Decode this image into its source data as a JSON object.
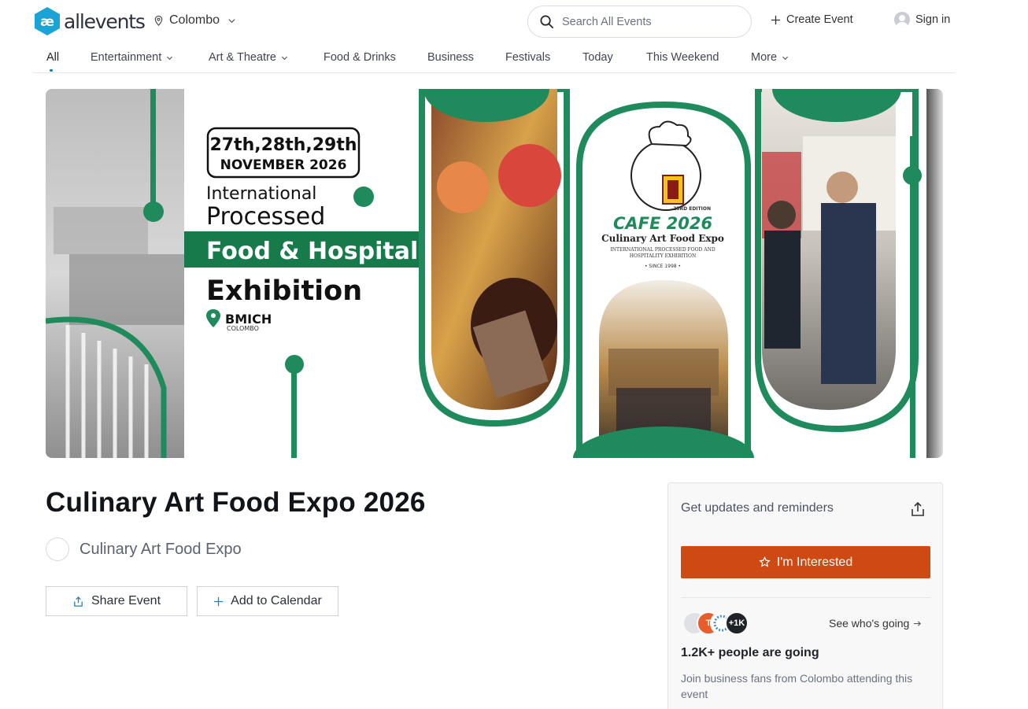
{
  "header": {
    "logo_text": "allevents",
    "location": "Colombo",
    "search_placeholder": "Search All Events",
    "create_event": "Create Event",
    "sign_in": "Sign in"
  },
  "nav": {
    "items": [
      {
        "label": "All"
      },
      {
        "label": "Entertainment"
      },
      {
        "label": "Art & Theatre"
      },
      {
        "label": "Food & Drinks"
      },
      {
        "label": "Business"
      },
      {
        "label": "Festivals"
      },
      {
        "label": "Today"
      },
      {
        "label": "This Weekend"
      },
      {
        "label": "More"
      }
    ]
  },
  "banner": {
    "dates": "27th,28th,29th",
    "month_year": "NOVEMBER 2026",
    "line1": "International",
    "line2": "Processed",
    "line3": "Food & Hospitality",
    "line4": "Exhibition",
    "venue": "BMICH",
    "venue_city": "COLOMBO",
    "edition": "23RD EDITION",
    "cafe": "CAFE 2026",
    "expo_name": "Culinary Art Food Expo",
    "expo_sub1": "INTERNATIONAL PROCESSED FOOD AND",
    "expo_sub2": "HOSPITALITY EXHIBITION",
    "since": "• SINCE 1998 •",
    "accent_green": "#1f8a5b",
    "dark_green": "#167a4a"
  },
  "event": {
    "title": "Culinary Art Food Expo 2026",
    "organizer": "Culinary Art Food Expo",
    "share_label": "Share Event",
    "calendar_label": "Add to Calendar"
  },
  "card": {
    "heading": "Get updates and reminders",
    "interested_label": "I'm Interested",
    "interested_color": "#cf4a12",
    "avatar_letter": "T",
    "more_count": "+1K",
    "see_going": "See who's going",
    "going_count": "1.2K+ people are going",
    "join_text": "Join business fans from Colombo attending this event"
  }
}
